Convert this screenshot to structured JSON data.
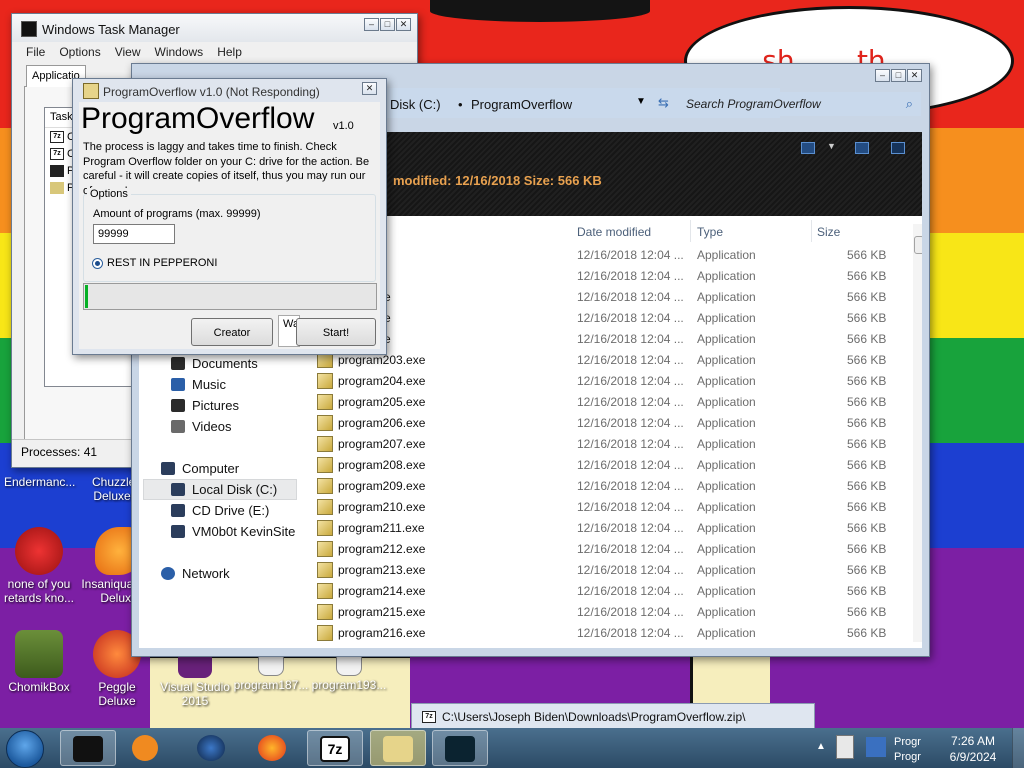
{
  "desktop": {
    "speech_text": "... ...sh ..... th",
    "icons": [
      {
        "id": "endermanch",
        "label": "Endermanc..."
      },
      {
        "id": "chuzzle",
        "label": "Chuzzle Deluxe"
      },
      {
        "id": "none",
        "label": "none of you retards kno..."
      },
      {
        "id": "insaniquarium",
        "label": "Insaniquarium Deluxe"
      },
      {
        "id": "chomikbox",
        "label": "ChomikBox"
      },
      {
        "id": "peggle",
        "label": "Peggle Deluxe"
      },
      {
        "id": "vs",
        "label": "Visual Studio 2015"
      },
      {
        "id": "p187",
        "label": "program187..."
      },
      {
        "id": "p193",
        "label": "program193..."
      }
    ]
  },
  "taskmgr": {
    "title": "Windows Task Manager",
    "menu": [
      "File",
      "Options",
      "View",
      "Windows",
      "Help"
    ],
    "tab_label": "Applicatio",
    "list_header": "Task",
    "rows": [
      "C",
      "C",
      "P",
      "P"
    ],
    "status": "Processes: 41"
  },
  "explorer": {
    "address": {
      "disk": "Disk (C:)",
      "folder": "ProgramOverflow"
    },
    "search_placeholder": "Search ProgramOverflow",
    "details_text": "modified: 12/16/2018 Size: 566 KB",
    "columns": {
      "date": "Date modified",
      "type": "Type",
      "size": "Size"
    },
    "nav": [
      {
        "label": "Documents",
        "color": "#2b2b2b"
      },
      {
        "label": "Music",
        "color": "#2b5fa8"
      },
      {
        "label": "Pictures",
        "color": "#2b2b2b"
      },
      {
        "label": "Videos",
        "color": "#6a6a6a"
      },
      {
        "label": "Computer",
        "color": "#2b3d5c"
      },
      {
        "label": "Local Disk (C:)",
        "color": "#2b3d5c"
      },
      {
        "label": "CD Drive (E:)",
        "color": "#2b3d5c"
      },
      {
        "label": "VM0b0t KevinSite",
        "color": "#2b3d5c"
      },
      {
        "label": "Network",
        "color": "#2b5fa8"
      }
    ],
    "files": [
      {
        "name": "...98.exe",
        "date": "12/16/2018 12:04 ...",
        "type": "Application",
        "size": "566 KB"
      },
      {
        "name": "...99.exe",
        "date": "12/16/2018 12:04 ...",
        "type": "Application",
        "size": "566 KB"
      },
      {
        "name": "...200.exe",
        "date": "12/16/2018 12:04 ...",
        "type": "Application",
        "size": "566 KB"
      },
      {
        "name": "...201.exe",
        "date": "12/16/2018 12:04 ...",
        "type": "Application",
        "size": "566 KB"
      },
      {
        "name": "...202.exe",
        "date": "12/16/2018 12:04 ...",
        "type": "Application",
        "size": "566 KB"
      },
      {
        "name": "program203.exe",
        "date": "12/16/2018 12:04 ...",
        "type": "Application",
        "size": "566 KB"
      },
      {
        "name": "program204.exe",
        "date": "12/16/2018 12:04 ...",
        "type": "Application",
        "size": "566 KB"
      },
      {
        "name": "program205.exe",
        "date": "12/16/2018 12:04 ...",
        "type": "Application",
        "size": "566 KB"
      },
      {
        "name": "program206.exe",
        "date": "12/16/2018 12:04 ...",
        "type": "Application",
        "size": "566 KB"
      },
      {
        "name": "program207.exe",
        "date": "12/16/2018 12:04 ...",
        "type": "Application",
        "size": "566 KB"
      },
      {
        "name": "program208.exe",
        "date": "12/16/2018 12:04 ...",
        "type": "Application",
        "size": "566 KB"
      },
      {
        "name": "program209.exe",
        "date": "12/16/2018 12:04 ...",
        "type": "Application",
        "size": "566 KB"
      },
      {
        "name": "program210.exe",
        "date": "12/16/2018 12:04 ...",
        "type": "Application",
        "size": "566 KB"
      },
      {
        "name": "program211.exe",
        "date": "12/16/2018 12:04 ...",
        "type": "Application",
        "size": "566 KB"
      },
      {
        "name": "program212.exe",
        "date": "12/16/2018 12:04 ...",
        "type": "Application",
        "size": "566 KB"
      },
      {
        "name": "program213.exe",
        "date": "12/16/2018 12:04 ...",
        "type": "Application",
        "size": "566 KB"
      },
      {
        "name": "program214.exe",
        "date": "12/16/2018 12:04 ...",
        "type": "Application",
        "size": "566 KB"
      },
      {
        "name": "program215.exe",
        "date": "12/16/2018 12:04 ...",
        "type": "Application",
        "size": "566 KB"
      },
      {
        "name": "program216.exe",
        "date": "12/16/2018 12:04 ...",
        "type": "Application",
        "size": "566 KB"
      }
    ]
  },
  "progov": {
    "title": "ProgramOverflow v1.0 (Not Responding)",
    "big_title": "ProgramOverflow",
    "version": "v1.0",
    "description": "The process is laggy and takes time to finish. Check Program Overflow folder on your C: drive for the action. Be careful - it will create copies of itself, thus you may run our of space!",
    "options_label": "Options",
    "amount_label": "Amount of programs (max. 99999)",
    "amount_value": "99999",
    "radio_label": "REST IN PEPPERONI",
    "progress_fraction": 0.01,
    "creator_label": "Creator",
    "wa_label": "Wa",
    "start_label": "Start!"
  },
  "path_popup": "C:\\Users\\Joseph Biden\\Downloads\\ProgramOverflow.zip\\",
  "taskbar": {
    "time": "7:26 AM",
    "date": "6/9/2024",
    "tray_label_a": "Progr",
    "tray_label_b": "Progr"
  },
  "colors": {
    "stripe_red": "#e9261c",
    "stripe_orange": "#f68f1e",
    "stripe_yellow": "#f8e617",
    "stripe_green": "#18a33c",
    "stripe_blue": "#1c3fd1",
    "stripe_purple": "#7c1fa4",
    "progress_green": "#06b025"
  }
}
